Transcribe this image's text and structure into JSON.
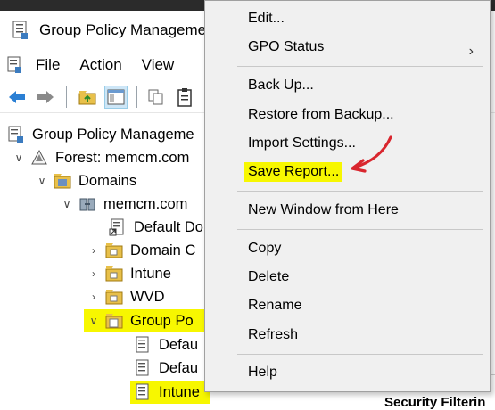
{
  "window": {
    "title": "Group Policy Manageme"
  },
  "menubar": {
    "items": [
      "File",
      "Action",
      "View"
    ]
  },
  "toolbar": {
    "icons": [
      "back-arrow-icon",
      "forward-arrow-icon",
      "folder-up-icon",
      "show-pane-icon",
      "copy-icon",
      "clipboard-icon"
    ]
  },
  "tree": {
    "root": "Group Policy Manageme",
    "forest": "Forest: memcm.com",
    "domains": "Domains",
    "domain": "memcm.com",
    "default_policy": "Default Do",
    "domain_controllers": "Domain C",
    "ou_intune": "Intune",
    "ou_wvd": "WVD",
    "gpo_container": "Group Po",
    "gpo_1": "Defau",
    "gpo_2": "Defau",
    "gpo_3": "Intune"
  },
  "details": {
    "security_filtering": "Security Filterin"
  },
  "context_menu": {
    "edit": "Edit...",
    "gpo_status": "GPO Status",
    "back_up": "Back Up...",
    "restore": "Restore from Backup...",
    "import": "Import Settings...",
    "save_report": "Save Report...",
    "new_window": "New Window from Here",
    "copy": "Copy",
    "delete": "Delete",
    "rename": "Rename",
    "refresh": "Refresh",
    "help": "Help"
  },
  "colors": {
    "highlight": "#f7f700",
    "annotation_arrow": "#d9262e",
    "menu_bg": "#f0f0f0"
  }
}
